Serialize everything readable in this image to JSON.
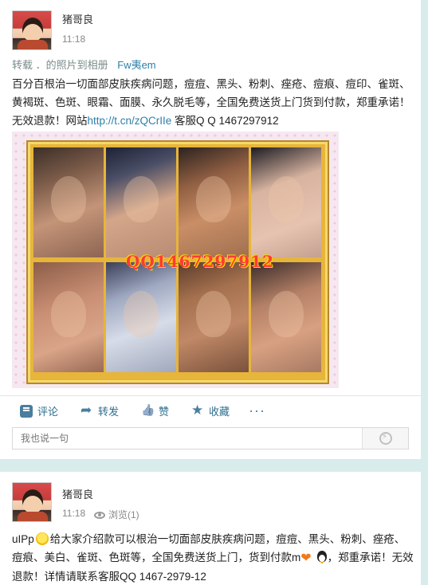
{
  "post1": {
    "username": "猪哥良",
    "time": "11:18",
    "repost": {
      "prefix": "转载 ．的照片到相册",
      "source": "Fw夷em"
    },
    "text_before_link": "百分百根治一切面部皮肤疾病问题，痘痘、黑头、粉刺、痤疮、痘痕、痘印、雀斑、黄褐斑、色斑、眼霜、面膜、永久脱毛等，全国免费送货上门货到付款，郑重承诺！无效退款！网站",
    "link": "http://t.cn/zQCrIIe",
    "text_after_link": " 客服Q Q 1467297912",
    "photo": {
      "watermark": "QQ1467297912"
    },
    "actions": [
      {
        "label": "评论",
        "icon": "comment-icon"
      },
      {
        "label": "转发",
        "icon": "share-icon"
      },
      {
        "label": "赞",
        "icon": "like-icon"
      },
      {
        "label": "收藏",
        "icon": "star-icon"
      }
    ],
    "more_label": "···",
    "comment": {
      "placeholder": "我也说一句"
    }
  },
  "post2": {
    "username": "猪哥良",
    "time": "11:18",
    "views": "浏览(1)",
    "text_part1": "uIPp",
    "text_part2": "给大家介绍款可以根治一切面部皮肤疾病问题，痘痘、黑头、粉刺、痤疮、痘痕、美白、雀斑、色斑等，全国免费送货上门，货到付款m",
    "text_part3": "，郑重承诺！无效退款！详情请联系客服QQ 1467-2979-12"
  }
}
